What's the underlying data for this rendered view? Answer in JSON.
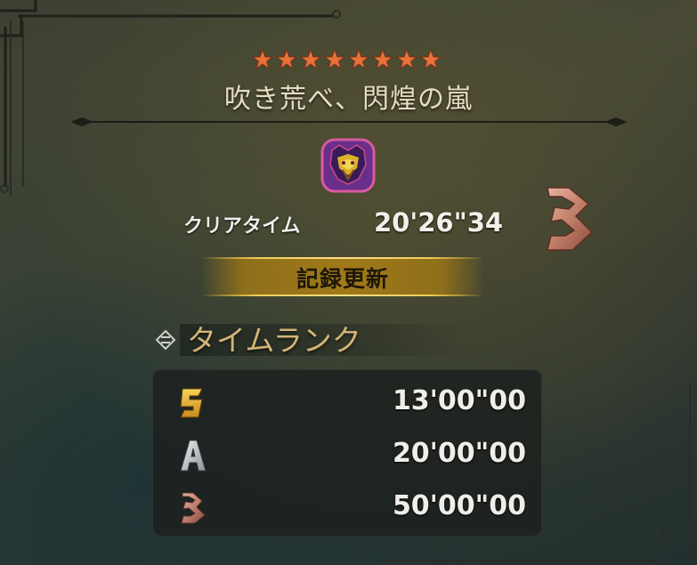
{
  "quest": {
    "stars": 8,
    "title": "吹き荒べ、閃煌の嵐",
    "monster_icon": "monster-portrait-icon"
  },
  "result": {
    "clear_time_label": "クリアタイム",
    "clear_time_value": "20'26\"34",
    "achieved_rank": "B",
    "record_label": "記録更新"
  },
  "time_rank": {
    "section_title": "タイムランク",
    "ranks": [
      {
        "rank": "S",
        "time": "13'00\"00",
        "color": "#e9b93c"
      },
      {
        "rank": "A",
        "time": "20'00\"00",
        "color": "#c8ccd0"
      },
      {
        "rank": "B",
        "time": "50'00\"00",
        "color": "#c98a74"
      }
    ]
  },
  "colors": {
    "star": "#e8713a",
    "title_text": "#e6dcc0",
    "banner_gold": "#a07a18",
    "section_title": "#d3b577"
  }
}
